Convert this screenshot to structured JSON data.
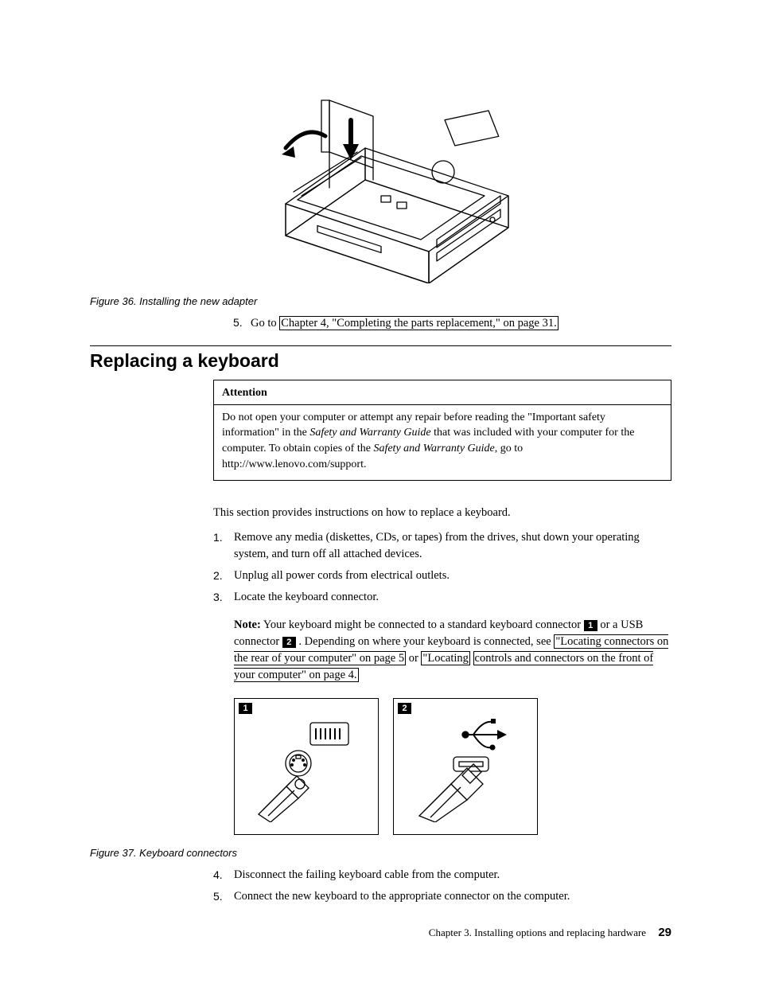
{
  "figure36": {
    "caption": "Figure 36. Installing the new adapter"
  },
  "step5_top": {
    "num": "5.",
    "prefix": "Go to ",
    "link": "Chapter 4, \"Completing the parts replacement,\" on page 31."
  },
  "section": {
    "heading": "Replacing a keyboard"
  },
  "attention": {
    "title": "Attention",
    "body_pre": "Do not open your computer or attempt any repair before reading the \"Important safety information\" in the ",
    "guide1": "Safety and Warranty Guide",
    "body_mid": " that was included with your computer for the computer. To obtain copies of the ",
    "guide2": "Safety and Warranty Guide",
    "body_post": ", go to http://www.lenovo.com/support."
  },
  "intro": "This section provides instructions on how to replace a keyboard.",
  "steps": {
    "s1": {
      "num": "1.",
      "text": "Remove any media (diskettes, CDs, or tapes) from the drives, shut down your operating system, and turn off all attached devices."
    },
    "s2": {
      "num": "2.",
      "text": "Unplug all power cords from electrical outlets."
    },
    "s3": {
      "num": "3.",
      "text": "Locate the keyboard connector.",
      "note_label": "Note:",
      "note_pre": " Your keyboard might be connected to a standard keyboard connector ",
      "c1": "1",
      "note_mid1": " or a USB connector ",
      "c2": "2",
      "note_mid2": " . Depending on where your keyboard is connected, see ",
      "link1": "\"Locating connectors on the rear of your computer\" on page 5",
      "note_or": " or ",
      "link2a": "\"Locating",
      "link2b": "controls and connectors on the front of your computer\" on page 4."
    },
    "s4": {
      "num": "4.",
      "text": "Disconnect the failing keyboard cable from the computer."
    },
    "s5": {
      "num": "5.",
      "text": "Connect the new keyboard to the appropriate connector on the computer."
    }
  },
  "figure37": {
    "label1": "1",
    "label2": "2",
    "caption": "Figure 37. Keyboard connectors"
  },
  "footer": {
    "chapter": "Chapter 3. Installing options and replacing hardware",
    "page": "29"
  }
}
